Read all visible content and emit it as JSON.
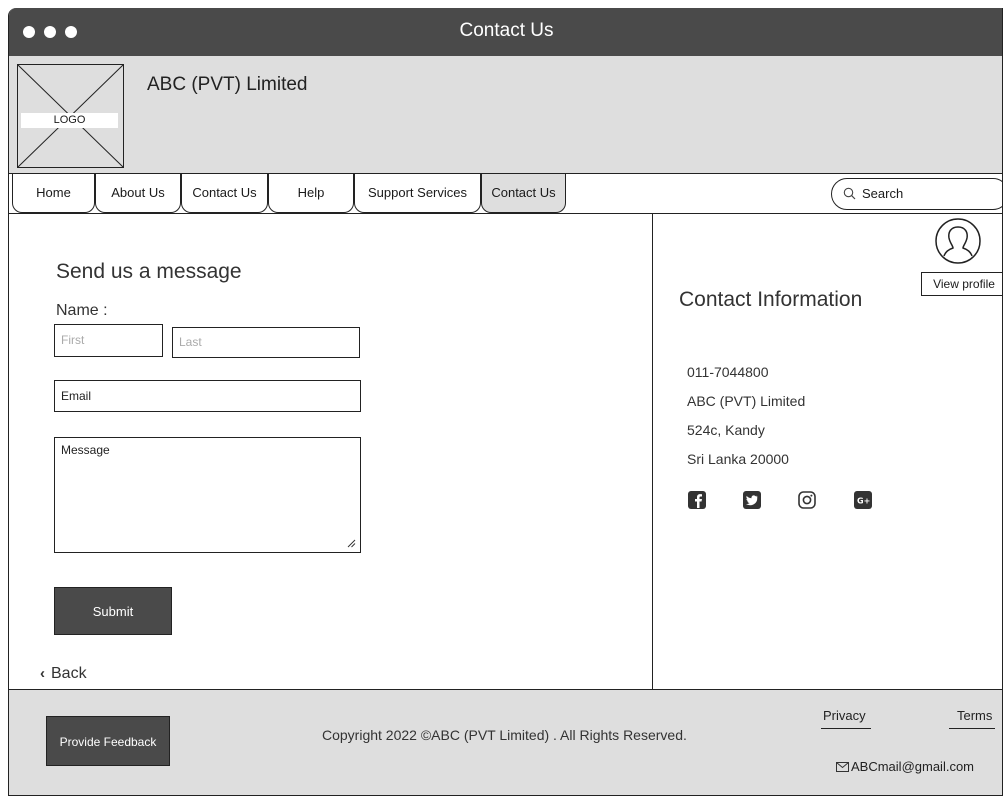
{
  "window": {
    "title": "Contact Us"
  },
  "header": {
    "logo_label": "LOGO",
    "company_name": "ABC (PVT) Limited"
  },
  "nav": {
    "tabs": [
      {
        "label": "Home"
      },
      {
        "label": "About Us"
      },
      {
        "label": "Contact Us"
      },
      {
        "label": "Help"
      },
      {
        "label": "Support Services"
      },
      {
        "label": "Contact Us"
      }
    ],
    "active_tab": "Contact Us",
    "search_placeholder": "Search"
  },
  "form": {
    "title": "Send us a message",
    "name_label": "Name :",
    "first_placeholder": "First",
    "last_placeholder": "Last",
    "email_label": "Email",
    "message_label": "Message",
    "submit_label": "Submit",
    "back_label": "Back"
  },
  "contact": {
    "view_profile_label": "View profile",
    "title": "Contact Information",
    "phone": "011-7044800",
    "company": "ABC (PVT) Limited",
    "address_line1": "524c, Kandy",
    "address_line2": "Sri Lanka 20000",
    "social_icons": [
      "facebook-icon",
      "twitter-icon",
      "instagram-icon",
      "google-plus-icon"
    ]
  },
  "footer": {
    "feedback_label": "Provide Feedback",
    "copyright": "Copyright 2022 ©ABC (PVT Limited) . All Rights Reserved.",
    "privacy_label": "Privacy",
    "terms_label": "Terms",
    "email": "ABCmail@gmail.com"
  },
  "colors": {
    "dark": "#4a4a4a",
    "light_gray": "#dedede",
    "border": "#222222"
  }
}
